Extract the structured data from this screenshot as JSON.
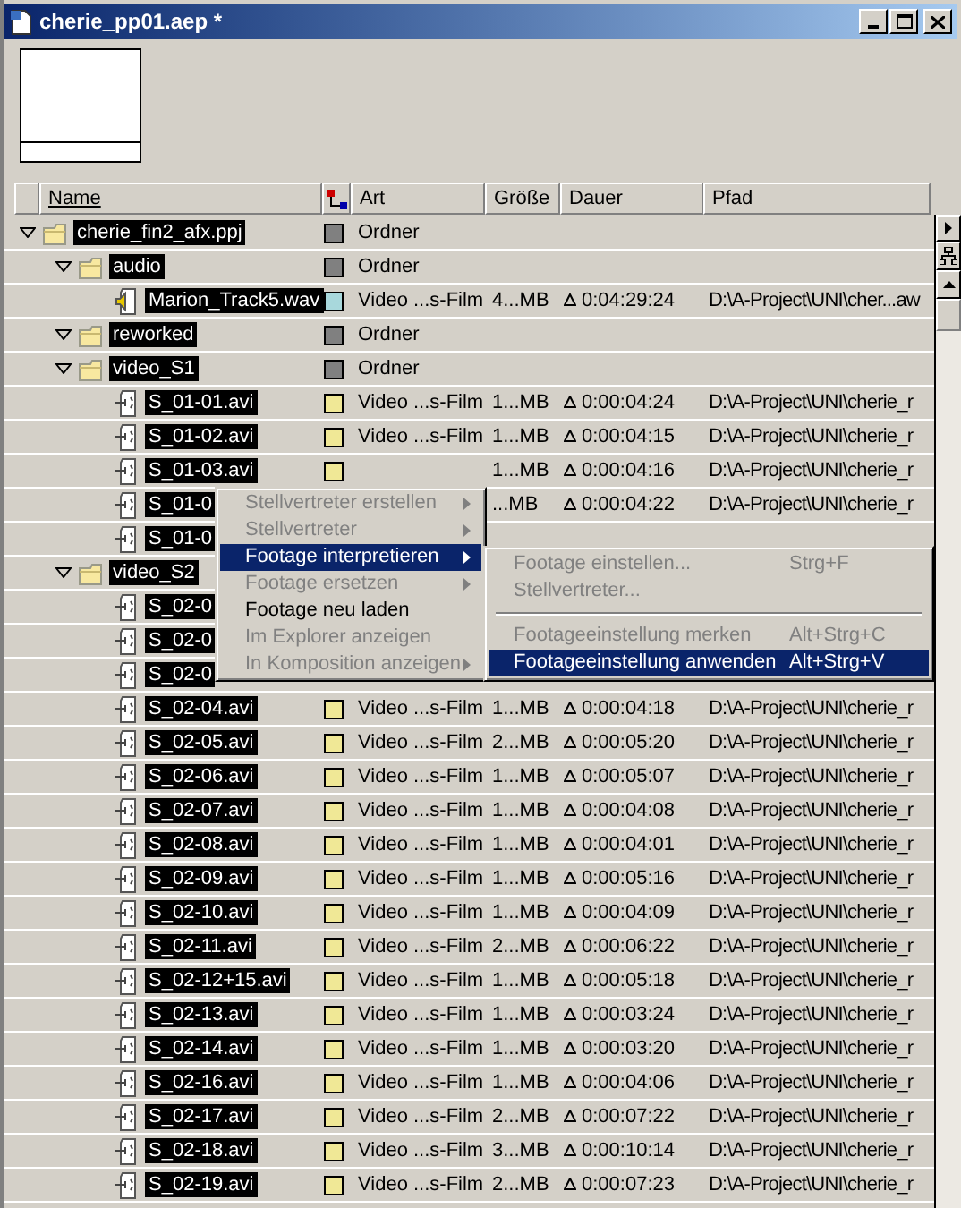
{
  "window": {
    "title": "cherie_pp01.aep *"
  },
  "columns": [
    "Name",
    "Art",
    "Größe",
    "Dauer",
    "Pfad"
  ],
  "tree": [
    {
      "kind": "folder",
      "name": "cherie_fin2_afx.ppj",
      "expanded": true,
      "color": "#808080",
      "art": "Ordner",
      "children": [
        {
          "kind": "folder",
          "name": "audio",
          "expanded": true,
          "color": "#808080",
          "art": "Ordner",
          "children": [
            {
              "kind": "audio",
              "name": "Marion_Track5.wav",
              "color": "#a8d8dc",
              "art": "Video ...s-Film",
              "size": "4...MB",
              "duration": "0:04:29:24",
              "path": "D:\\A-Project\\UNI\\cher...aw"
            }
          ]
        },
        {
          "kind": "folder",
          "name": "reworked",
          "expanded": true,
          "color": "#808080",
          "art": "Ordner"
        },
        {
          "kind": "folder",
          "name": "video_S1",
          "expanded": true,
          "color": "#808080",
          "art": "Ordner",
          "children": [
            {
              "kind": "video",
              "name": "S_01-01.avi",
              "color": "#f0e896",
              "art": "Video ...s-Film",
              "size": "1...MB",
              "duration": "0:00:04:24",
              "path": "D:\\A-Project\\UNI\\cherie_r"
            },
            {
              "kind": "video",
              "name": "S_01-02.avi",
              "color": "#f0e896",
              "art": "Video ...s-Film",
              "size": "1...MB",
              "duration": "0:00:04:15",
              "path": "D:\\A-Project\\UNI\\cherie_r"
            },
            {
              "kind": "video",
              "name": "S_01-03.avi",
              "color": "#f0e896",
              "size": "1...MB",
              "duration": "0:00:04:16",
              "path": "D:\\A-Project\\UNI\\cherie_r"
            },
            {
              "kind": "video",
              "name": "S_01-0",
              "size": "...MB",
              "duration": "0:00:04:22",
              "path": "D:\\A-Project\\UNI\\cherie_r"
            },
            {
              "kind": "video",
              "name": "S_01-0"
            }
          ]
        },
        {
          "kind": "folder",
          "name": "video_S2",
          "expanded": true,
          "children": [
            {
              "kind": "video",
              "name": "S_02-0"
            },
            {
              "kind": "video",
              "name": "S_02-0"
            },
            {
              "kind": "video",
              "name": "S_02-0"
            },
            {
              "kind": "video",
              "name": "S_02-04.avi",
              "color": "#f0e896",
              "art": "Video ...s-Film",
              "size": "1...MB",
              "duration": "0:00:04:18",
              "path": "D:\\A-Project\\UNI\\cherie_r"
            },
            {
              "kind": "video",
              "name": "S_02-05.avi",
              "color": "#f0e896",
              "art": "Video ...s-Film",
              "size": "2...MB",
              "duration": "0:00:05:20",
              "path": "D:\\A-Project\\UNI\\cherie_r"
            },
            {
              "kind": "video",
              "name": "S_02-06.avi",
              "color": "#f0e896",
              "art": "Video ...s-Film",
              "size": "1...MB",
              "duration": "0:00:05:07",
              "path": "D:\\A-Project\\UNI\\cherie_r"
            },
            {
              "kind": "video",
              "name": "S_02-07.avi",
              "color": "#f0e896",
              "art": "Video ...s-Film",
              "size": "1...MB",
              "duration": "0:00:04:08",
              "path": "D:\\A-Project\\UNI\\cherie_r"
            },
            {
              "kind": "video",
              "name": "S_02-08.avi",
              "color": "#f0e896",
              "art": "Video ...s-Film",
              "size": "1...MB",
              "duration": "0:00:04:01",
              "path": "D:\\A-Project\\UNI\\cherie_r"
            },
            {
              "kind": "video",
              "name": "S_02-09.avi",
              "color": "#f0e896",
              "art": "Video ...s-Film",
              "size": "1...MB",
              "duration": "0:00:05:16",
              "path": "D:\\A-Project\\UNI\\cherie_r"
            },
            {
              "kind": "video",
              "name": "S_02-10.avi",
              "color": "#f0e896",
              "art": "Video ...s-Film",
              "size": "1...MB",
              "duration": "0:00:04:09",
              "path": "D:\\A-Project\\UNI\\cherie_r"
            },
            {
              "kind": "video",
              "name": "S_02-11.avi",
              "color": "#f0e896",
              "art": "Video ...s-Film",
              "size": "2...MB",
              "duration": "0:00:06:22",
              "path": "D:\\A-Project\\UNI\\cherie_r"
            },
            {
              "kind": "video",
              "name": "S_02-12+15.avi",
              "color": "#f0e896",
              "art": "Video ...s-Film",
              "size": "1...MB",
              "duration": "0:00:05:18",
              "path": "D:\\A-Project\\UNI\\cherie_r"
            },
            {
              "kind": "video",
              "name": "S_02-13.avi",
              "color": "#f0e896",
              "art": "Video ...s-Film",
              "size": "1...MB",
              "duration": "0:00:03:24",
              "path": "D:\\A-Project\\UNI\\cherie_r"
            },
            {
              "kind": "video",
              "name": "S_02-14.avi",
              "color": "#f0e896",
              "art": "Video ...s-Film",
              "size": "1...MB",
              "duration": "0:00:03:20",
              "path": "D:\\A-Project\\UNI\\cherie_r"
            },
            {
              "kind": "video",
              "name": "S_02-16.avi",
              "color": "#f0e896",
              "art": "Video ...s-Film",
              "size": "1...MB",
              "duration": "0:00:04:06",
              "path": "D:\\A-Project\\UNI\\cherie_r"
            },
            {
              "kind": "video",
              "name": "S_02-17.avi",
              "color": "#f0e896",
              "art": "Video ...s-Film",
              "size": "2...MB",
              "duration": "0:00:07:22",
              "path": "D:\\A-Project\\UNI\\cherie_r"
            },
            {
              "kind": "video",
              "name": "S_02-18.avi",
              "color": "#f0e896",
              "art": "Video ...s-Film",
              "size": "3...MB",
              "duration": "0:00:10:14",
              "path": "D:\\A-Project\\UNI\\cherie_r"
            },
            {
              "kind": "video",
              "name": "S_02-19.avi",
              "color": "#f0e896",
              "art": "Video ...s-Film",
              "size": "2...MB",
              "duration": "0:00:07:23",
              "path": "D:\\A-Project\\UNI\\cherie_r"
            }
          ]
        }
      ]
    }
  ],
  "context_menu": [
    {
      "kind": "item",
      "label": "Stellvertreter erstellen",
      "disabled": true,
      "selected": false,
      "submenu": true
    },
    {
      "kind": "item",
      "label": "Stellvertreter",
      "disabled": true,
      "selected": false,
      "submenu": true
    },
    {
      "kind": "item",
      "label": "Footage interpretieren",
      "disabled": false,
      "selected": true,
      "submenu": true
    },
    {
      "kind": "item",
      "label": "Footage ersetzen",
      "disabled": true,
      "selected": false,
      "submenu": true
    },
    {
      "kind": "item",
      "label": "Footage neu laden",
      "disabled": false,
      "selected": false,
      "submenu": false
    },
    {
      "kind": "item",
      "label": "Im Explorer anzeigen",
      "disabled": true,
      "selected": false,
      "submenu": false
    },
    {
      "kind": "item",
      "label": "In Komposition anzeigen",
      "disabled": true,
      "selected": false,
      "submenu": true
    }
  ],
  "submenu": [
    {
      "kind": "item",
      "label": "Footage einstellen...",
      "shortcut": "Strg+F",
      "disabled": true,
      "selected": false
    },
    {
      "kind": "item",
      "label": "Stellvertreter...",
      "disabled": true,
      "selected": false
    },
    {
      "kind": "separator"
    },
    {
      "kind": "item",
      "label": "Footageeinstellung merken",
      "shortcut": "Alt+Strg+C",
      "disabled": true,
      "selected": false
    },
    {
      "kind": "item",
      "label": "Footageeinstellung anwenden",
      "shortcut": "Alt+Strg+V",
      "disabled": false,
      "selected": true
    }
  ]
}
